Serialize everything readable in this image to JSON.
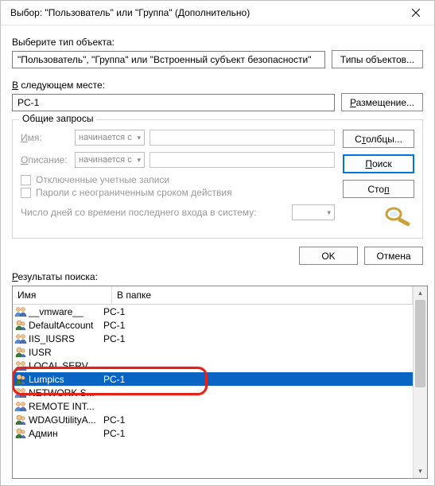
{
  "title": "Выбор: \"Пользователь\" или \"Группа\" (Дополнительно)",
  "section1": {
    "label_html": "Выберите тип объекта:",
    "value": "\"Пользователь\", \"Группа\" или \"Встроенный субъект безопасности\"",
    "button": "Типы объектов..."
  },
  "section2": {
    "label_prefix": "В",
    "label_rest": " следующем месте:",
    "value": "PC-1",
    "button": "Размещение..."
  },
  "group": {
    "title": "Общие запросы",
    "name_prefix": "И",
    "name_rest": "мя:",
    "desc_prefix": "О",
    "desc_rest": "писание:",
    "combo_value": "начинается с",
    "chk1": "Отключенные учетные записи",
    "chk2": "Пароли с неограниченным сроком действия",
    "days_label": "Число дней со времени последнего входа в систему:"
  },
  "side_buttons": {
    "columns": "Столбцы...",
    "search_prefix": "П",
    "search_rest": "оиск",
    "stop": "Стоп"
  },
  "footer": {
    "ok": "OK",
    "cancel": "Отмена"
  },
  "results": {
    "label_prefix": "Р",
    "label_rest": "езультаты поиска:",
    "col_name": "Имя",
    "col_folder": "В папке",
    "rows": [
      {
        "icon": "group",
        "name": "__vmware__",
        "folder": "PC-1",
        "selected": false
      },
      {
        "icon": "user",
        "name": "DefaultAccount",
        "folder": "PC-1",
        "selected": false
      },
      {
        "icon": "group",
        "name": "IIS_IUSRS",
        "folder": "PC-1",
        "selected": false
      },
      {
        "icon": "user",
        "name": "IUSR",
        "folder": "",
        "selected": false
      },
      {
        "icon": "group",
        "name": "LOCAL SERV...",
        "folder": "",
        "selected": false
      },
      {
        "icon": "user",
        "name": "Lumpics",
        "folder": "PC-1",
        "selected": true
      },
      {
        "icon": "group",
        "name": "NETWORK S...",
        "folder": "",
        "selected": false
      },
      {
        "icon": "group",
        "name": "REMOTE INT...",
        "folder": "",
        "selected": false
      },
      {
        "icon": "user",
        "name": "WDAGUtilityA...",
        "folder": "PC-1",
        "selected": false
      },
      {
        "icon": "user",
        "name": "Админ",
        "folder": "PC-1",
        "selected": false
      }
    ]
  }
}
